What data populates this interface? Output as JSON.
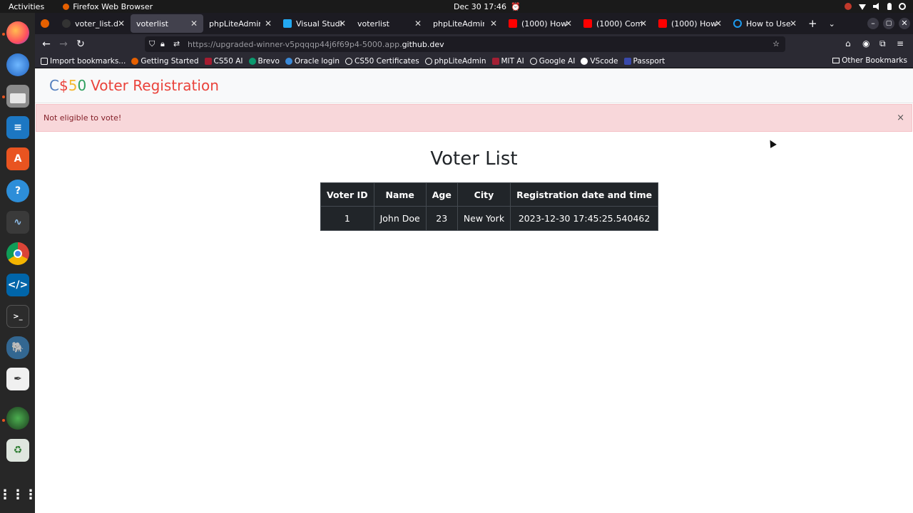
{
  "system": {
    "activities": "Activities",
    "app_name": "Firefox Web Browser",
    "clock": "Dec 30  17:46"
  },
  "dock": {
    "items": [
      "firefox-icon",
      "thunderbird-icon",
      "files-icon",
      "writer-icon",
      "software-icon",
      "help-icon",
      "monitor-icon",
      "chrome-icon",
      "vscode-icon",
      "terminal-icon",
      "postgres-icon",
      "inkscape-icon",
      "globe-icon",
      "trash-icon",
      "apps-grid-icon"
    ]
  },
  "tabs": [
    {
      "title": "voter_list.db - ",
      "active": false
    },
    {
      "title": "voterlist",
      "active": true
    },
    {
      "title": "phpLiteAdmin",
      "active": false
    },
    {
      "title": "Visual Studio C",
      "active": false
    },
    {
      "title": "voterlist",
      "active": false
    },
    {
      "title": "phpLiteAdmin",
      "active": false
    },
    {
      "title": "(1000) How To",
      "active": false
    },
    {
      "title": "(1000) Complet",
      "active": false
    },
    {
      "title": "(1000) How & V",
      "active": false
    },
    {
      "title": "How to Use Fla",
      "active": false
    }
  ],
  "url": {
    "prefix": "https://upgraded-winner-v5pqqqp44j6f69p4-5000.app.",
    "host": "github.dev"
  },
  "bookmarks": {
    "items": [
      "Import bookmarks...",
      "Getting Started",
      "CS50 AI",
      "Brevo",
      "Oracle login",
      "CS50 Certificates",
      "phpLiteAdmin",
      "MIT AI",
      "Google AI",
      "VScode",
      "Passport"
    ],
    "other": "Other Bookmarks"
  },
  "app": {
    "brand_c": "C",
    "brand_dollar": "$",
    "brand_5": "5",
    "brand_0": "0",
    "brand_rest": "Voter Registration",
    "alert": "Not eligible to vote!",
    "alert_close": "×",
    "heading": "Voter List",
    "table": {
      "headers": [
        "Voter ID",
        "Name",
        "Age",
        "City",
        "Registration date and time"
      ],
      "rows": [
        [
          "1",
          "John Doe",
          "23",
          "New York",
          "2023-12-30 17:45:25.540462"
        ]
      ]
    }
  }
}
